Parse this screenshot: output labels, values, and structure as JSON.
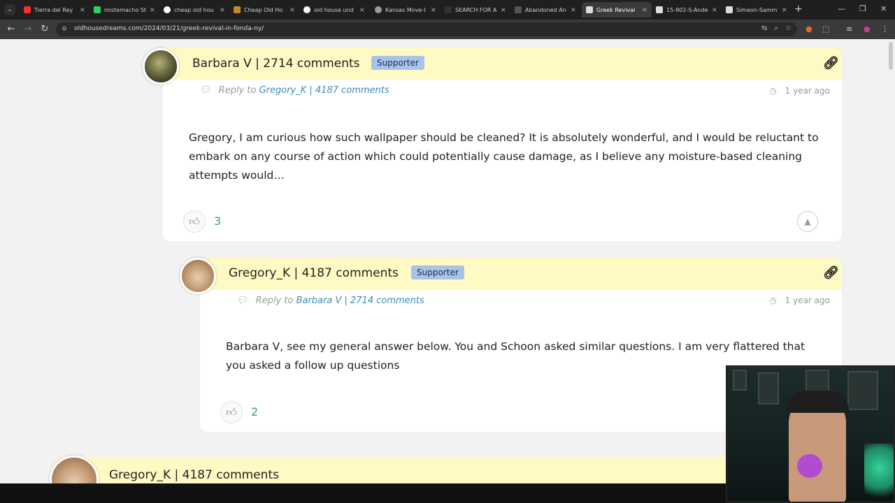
{
  "browser": {
    "tabs": [
      {
        "title": "Tierra del Rey",
        "color": "#ff2a2a"
      },
      {
        "title": "mistemacho St",
        "color": "#2ad15a"
      },
      {
        "title": "cheap old hou",
        "color": "#ffffff"
      },
      {
        "title": "Cheap Old Ho",
        "color": "#c8892a"
      },
      {
        "title": "old house und",
        "color": "#ffffff"
      },
      {
        "title": "Kansas Move-I",
        "color": "#9a9a9a"
      },
      {
        "title": "SEARCH FOR A",
        "color": "#333333"
      },
      {
        "title": "Abandoned An",
        "color": "#555555"
      },
      {
        "title": "Greek Revival",
        "color": "#dddddd",
        "active": true
      },
      {
        "title": "15-802-S-Ande",
        "color": "#dddddd"
      },
      {
        "title": "Simeon-Samm",
        "color": "#dddddd"
      }
    ],
    "url": "oldhousedreams.com/2024/03/21/greek-revival-in-fonda-ny/"
  },
  "comments": [
    {
      "author": "Barbara V | 2714 comments",
      "badge": "Supporter",
      "reply_prefix": "Reply to",
      "reply_to": "Gregory_K | 4187 comments",
      "time": "1 year ago",
      "body": "Gregory, I am curious how such wallpaper should be cleaned? It is absolutely wonderful, and I would be reluctant to embark on any course of action which could potentially cause damage, as I believe any moisture-based cleaning attempts would…",
      "likes": "3"
    },
    {
      "author": "Gregory_K | 4187 comments",
      "badge": "Supporter",
      "reply_prefix": "Reply to",
      "reply_to": "Barbara V | 2714 comments",
      "time": "1 year ago",
      "body": "Barbara V, see my general answer below. You and Schoon asked similar questions. I am very flattered that you asked a follow up questions",
      "likes": "2"
    },
    {
      "author": "Gregory_K | 4187 comments"
    }
  ]
}
